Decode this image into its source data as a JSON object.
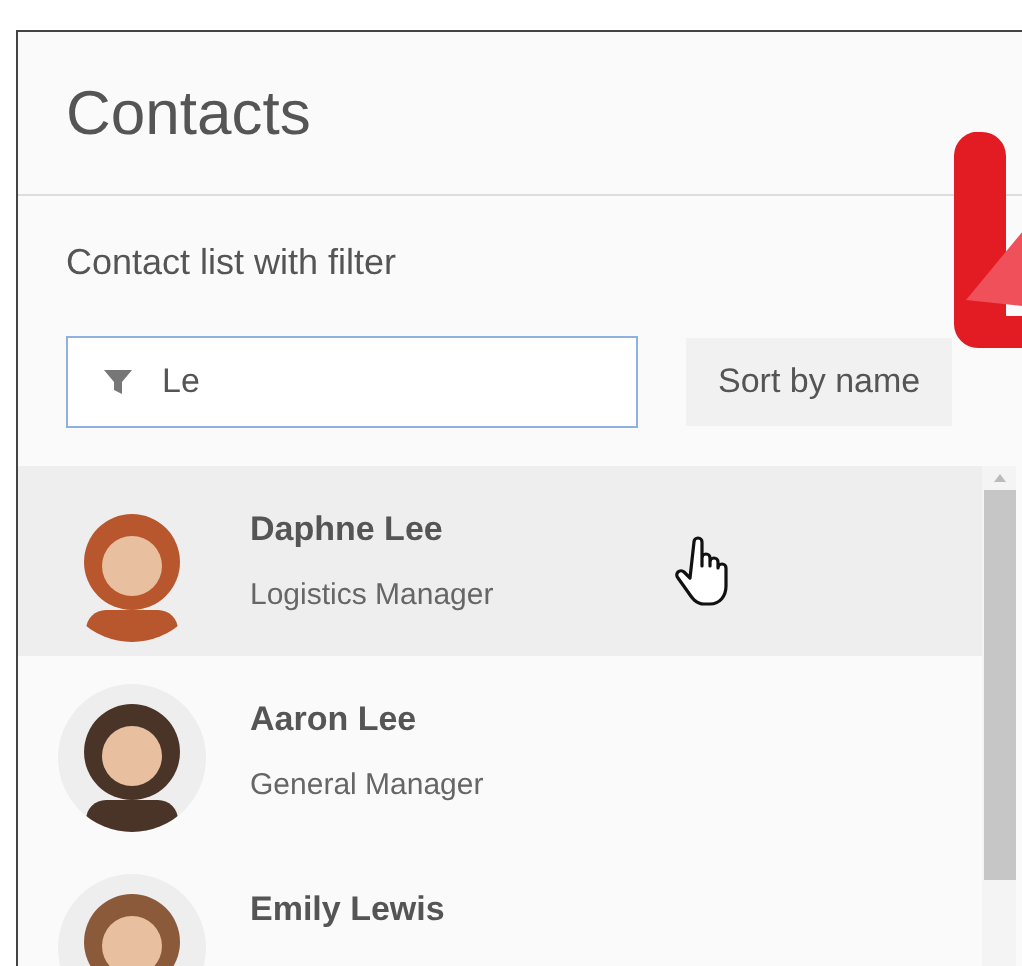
{
  "window": {
    "title": "Contacts"
  },
  "subtitle": "Contact list with filter",
  "filter": {
    "value": "Le"
  },
  "sort_button": {
    "label": "Sort by name"
  },
  "contacts": [
    {
      "name": "Daphne Lee",
      "role": "Logistics Manager",
      "selected": true,
      "color": "#b8562e"
    },
    {
      "name": "Aaron Lee",
      "role": "General Manager",
      "selected": false,
      "color": "#4a3428"
    },
    {
      "name": "Emily Lewis",
      "selected": false,
      "color": "#8a5a3a"
    }
  ]
}
